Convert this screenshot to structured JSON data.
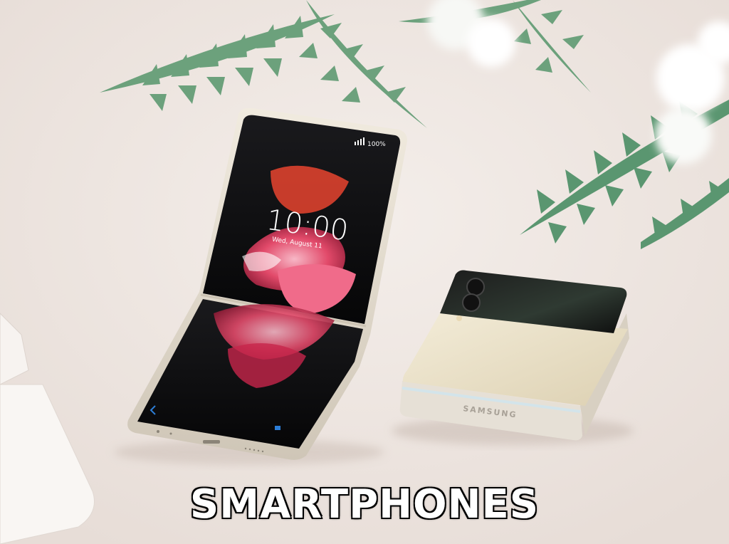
{
  "caption": "SMARTPHONES",
  "phone": {
    "status": "100%",
    "clock": "10:00",
    "date": "Wed, August 11",
    "brand": "SAMSUNG"
  },
  "colors": {
    "background": "#efe7e2",
    "leaf": "#5f9a72",
    "phone_cream": "#efe6cf",
    "screen_black": "#0b0b0d",
    "flower_pink": "#e24a6a",
    "caption_text": "#ffffff",
    "caption_outline": "#000000"
  }
}
